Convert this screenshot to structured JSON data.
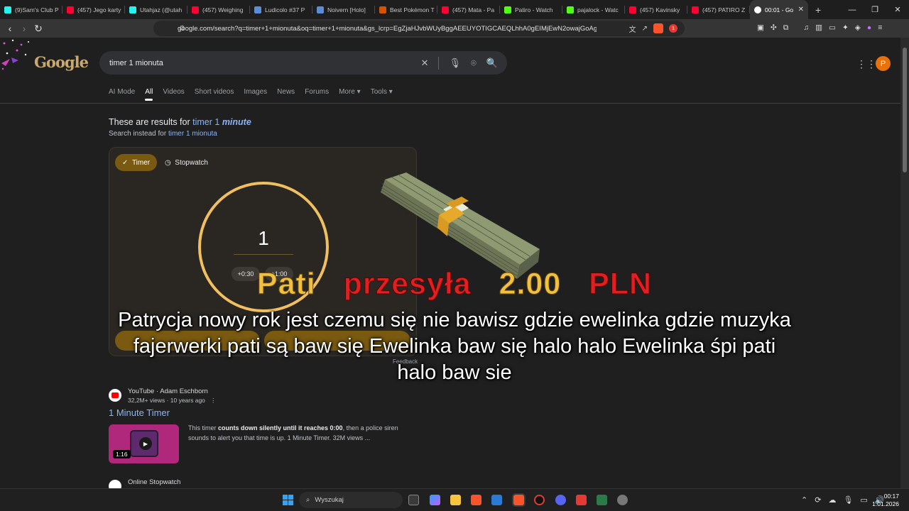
{
  "tabs": [
    {
      "label": "(9)Sam's Club P",
      "icon": "tiktok-icon",
      "color": "#25f4ee"
    },
    {
      "label": "(457) Jego karty",
      "icon": "youtube-icon",
      "color": "#ff0033"
    },
    {
      "label": "Utahjaz (@utah",
      "icon": "tiktok-icon",
      "color": "#25f4ee"
    },
    {
      "label": "(457) Weighing",
      "icon": "youtube-icon",
      "color": "#ff0033"
    },
    {
      "label": "Ludicolo #37 P",
      "icon": "pokemon-icon",
      "color": "#5b8dd6"
    },
    {
      "label": "Noivern [Holo]",
      "icon": "pokemon-icon",
      "color": "#5b8dd6"
    },
    {
      "label": "Best Pokémon T",
      "icon": "k-icon",
      "color": "#d35400"
    },
    {
      "label": "(457) Mata - Pa",
      "icon": "youtube-icon",
      "color": "#ff0033"
    },
    {
      "label": "Patiro - Watch",
      "icon": "kick-icon",
      "color": "#53fc18"
    },
    {
      "label": "pajalock - Watc",
      "icon": "kick-icon",
      "color": "#53fc18"
    },
    {
      "label": "(457) Kavinsky",
      "icon": "youtube-icon",
      "color": "#ff0033"
    },
    {
      "label": "(457) PATIRO Z",
      "icon": "youtube-icon",
      "color": "#ff0033"
    }
  ],
  "active_tab": {
    "label": "00:01 - Go",
    "icon": "google-icon"
  },
  "toolbar": {
    "url": "google.com/search?q=timer+1+mionuta&oq=timer+1+mionuta&gs_lcrp=EgZjaHJvbWUyBggAEEUYOTIGCAEQLhhA0gEIMjEwN2owajGoAgCw...",
    "brave_badge": "1"
  },
  "google": {
    "logo": "Google",
    "query": "timer 1 mionuta",
    "avatar_letter": "P",
    "tabs": [
      "AI Mode",
      "All",
      "Videos",
      "Short videos",
      "Images",
      "News",
      "Forums",
      "More ▾",
      "Tools ▾"
    ],
    "active_tab": "All",
    "correction_prefix": "These are results for",
    "correction_query": "timer 1",
    "correction_em": "minute",
    "instead_prefix": "Search instead for",
    "instead_query": "timer 1 mionuta"
  },
  "timer_widget": {
    "timer_label": "Timer",
    "stopwatch_label": "Stopwatch",
    "value": "1",
    "add30": "+0:30",
    "add60": "+1:00",
    "accent": "#f0c060"
  },
  "feedback": "Feedback",
  "result1": {
    "source": "YouTube · Adam Eschborn",
    "meta": "32,2M+ views · 10 years ago",
    "title": "1 Minute Timer",
    "duration": "1:16",
    "snippet_pre": "This timer ",
    "snippet_bold": "counts down silently until it reaches 0:00",
    "snippet_post": ", then a police siren sounds to alert you that time is up. 1 Minute Timer. 32M views ..."
  },
  "result2": {
    "source": "Online Stopwatch"
  },
  "donation": {
    "name": "Pati",
    "verb": "przesyła",
    "amount": "2.00",
    "currency": "PLN",
    "message": "Patrycja nowy rok jest czemu się nie bawisz gdzie ewelinka gdzie muzyka fajerwerki pati są baw się Ewelinka baw się halo halo Ewelinka śpi pati halo baw sie"
  },
  "taskbar": {
    "search_placeholder": "Wyszukaj",
    "time": "00:17",
    "date": "1.01.2026"
  }
}
